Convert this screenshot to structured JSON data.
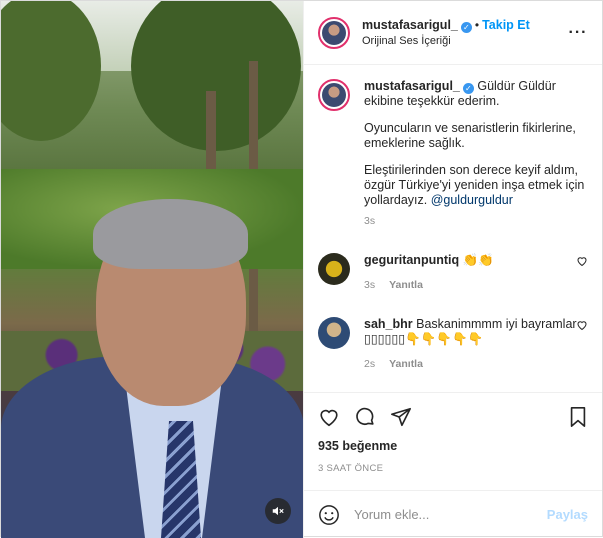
{
  "header": {
    "username": "mustafasarigul_",
    "follow_label": "Takip Et",
    "audio_label": "Orijinal Ses İçeriği"
  },
  "caption": {
    "username": "mustafasarigul_",
    "line1": "Güldür Güldür ekibine teşekkür ederim.",
    "line2": "Oyuncuların ve senaristlerin fikirlerine, emeklerine sağlık.",
    "line3": "Eleştirilerinden son derece keyif aldım, özgür Türkiye'yi yeniden inşa etmek için yollardayız.",
    "mention": "@guldurguldur",
    "time": "3s"
  },
  "comments": [
    {
      "username": "geguritanpuntiq",
      "text": "👏👏",
      "time": "3s",
      "reply_label": "Yanıtla"
    },
    {
      "username": "sah_bhr",
      "text": "Baskanimmmm iyi bayramlar ▯▯▯▯▯▯👇👇👇👇👇",
      "time": "2s",
      "reply_label": "Yanıtla"
    }
  ],
  "post": {
    "likes": "935 beğenme",
    "ago": "3 SAAT ÖNCE"
  },
  "composer": {
    "placeholder": "Yorum ekle...",
    "post_label": "Paylaş"
  },
  "colors": {
    "accent": "#0095f6",
    "verified": "#3897f0"
  }
}
